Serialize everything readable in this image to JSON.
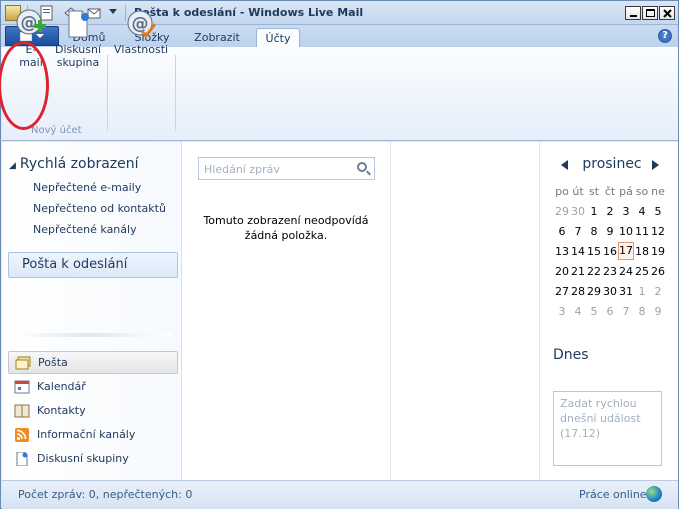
{
  "window": {
    "title": "Pošta k odeslání - Windows Live Mail"
  },
  "ribbon": {
    "tabs": [
      "Domů",
      "Složky",
      "Zobrazit",
      "Účty"
    ],
    "active_tab": "Účty",
    "help_label": "?",
    "buttons": {
      "email": "E-\nmail",
      "newsgroup": "Diskusní\nskupina",
      "properties": "Vlastnosti"
    },
    "group_label": "Nový účet"
  },
  "left_pane": {
    "quick_views_title": "Rychlá zobrazení",
    "quick_views": [
      "Nepřečtené e-maily",
      "Nepřečteno od kontaktů",
      "Nepřečtené kanály"
    ],
    "selected_folder": "Pošta k odeslání",
    "nav_items": [
      {
        "label": "Pošta",
        "icon": "mail-icon"
      },
      {
        "label": "Kalendář",
        "icon": "calendar-icon"
      },
      {
        "label": "Kontakty",
        "icon": "contacts-icon"
      },
      {
        "label": "Informační kanály",
        "icon": "rss-icon"
      },
      {
        "label": "Diskusní skupiny",
        "icon": "newsgroup-icon"
      }
    ]
  },
  "message_list": {
    "search_placeholder": "Hledání zpráv",
    "empty_text": "Tomuto zobrazení neodpovídá žádná položka."
  },
  "calendar": {
    "month": "prosinec",
    "weekdays": [
      "po",
      "út",
      "st",
      "čt",
      "pá",
      "so",
      "ne"
    ],
    "weeks": [
      [
        "29",
        "30",
        "1",
        "2",
        "3",
        "4",
        "5"
      ],
      [
        "6",
        "7",
        "8",
        "9",
        "10",
        "11",
        "12"
      ],
      [
        "13",
        "14",
        "15",
        "16",
        "17",
        "18",
        "19"
      ],
      [
        "20",
        "21",
        "22",
        "23",
        "24",
        "25",
        "26"
      ],
      [
        "27",
        "28",
        "29",
        "30",
        "31",
        "1",
        "2"
      ],
      [
        "3",
        "4",
        "5",
        "6",
        "7",
        "8",
        "9"
      ]
    ],
    "today": "17",
    "today_label": "Dnes",
    "event_placeholder": "Zadat rychlou dnešní událost (17.12)"
  },
  "status_bar": {
    "left": "Počet zpráv: 0, nepřečtených: 0",
    "right": "Práce online"
  },
  "colors": {
    "accent": "#1b4e9c",
    "highlight_circle": "#e0222f"
  }
}
